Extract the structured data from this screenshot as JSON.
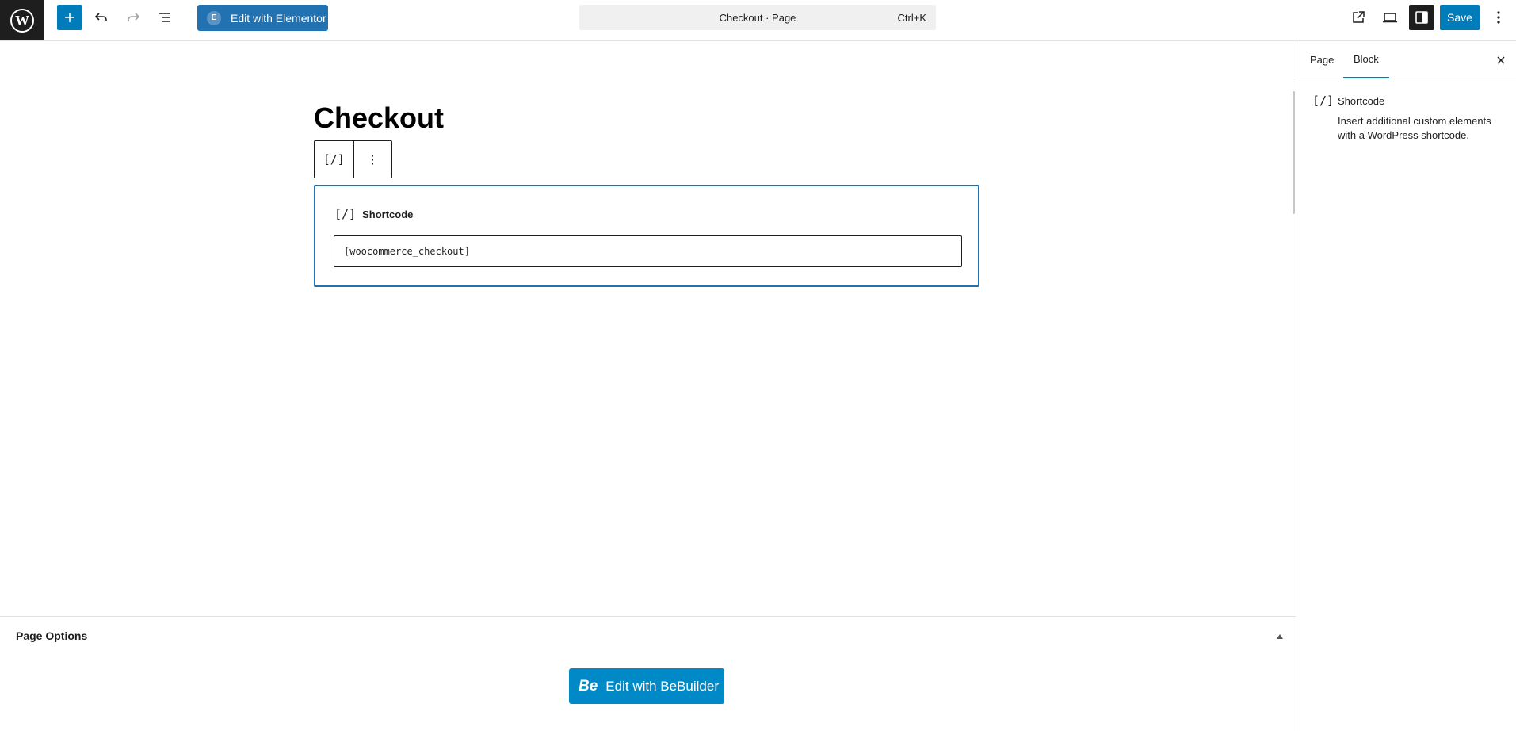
{
  "topbar": {
    "wp_logo": "W",
    "elementor_label": "Edit with Elementor",
    "elementor_badge": "E",
    "command_title": "Checkout · Page",
    "command_shortcut": "Ctrl+K",
    "save_label": "Save"
  },
  "canvas": {
    "page_title": "Checkout",
    "block_icon": "[/]",
    "more_icon": "⋮",
    "shortcode_label": "Shortcode",
    "shortcode_value": "[woocommerce_checkout]"
  },
  "page_options": {
    "title": "Page Options",
    "bebuilder_badge": "Be",
    "bebuilder_label": "Edit with BeBuilder"
  },
  "sidebar": {
    "tabs": [
      {
        "label": "Page"
      },
      {
        "label": "Block"
      }
    ],
    "block_card": {
      "icon": "[/]",
      "name": "Shortcode",
      "description": "Insert additional custom elements with a WordPress shortcode."
    }
  },
  "colors": {
    "accent": "#007cba",
    "elementor": "#2271b1",
    "bebuilder": "#0089c7",
    "dark": "#1e1e1e"
  }
}
